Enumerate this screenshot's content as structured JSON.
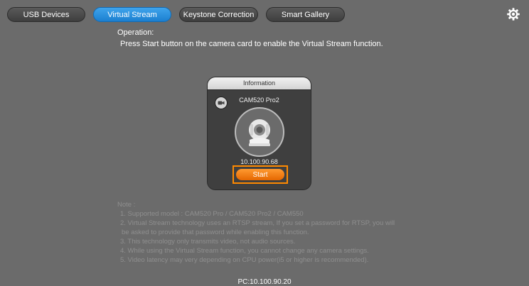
{
  "tabs": [
    {
      "label": "USB Devices",
      "active": false
    },
    {
      "label": "Virtual Stream",
      "active": true
    },
    {
      "label": "Keystone Correction",
      "active": false
    },
    {
      "label": "Smart Gallery",
      "active": false
    }
  ],
  "settings_icon": "gear-icon",
  "operation": {
    "title": "Operation:",
    "text": "Press Start button on the camera card to enable the Virtual Stream function."
  },
  "card": {
    "header": "Information",
    "model": "CAM520 Pro2",
    "ip": "10.100.90.68",
    "start_label": "Start",
    "camera_badge_icon": "video-camera-icon",
    "camera_image_icon": "ptz-camera-icon"
  },
  "notes": {
    "title": "Note :",
    "lines": [
      "1. Supported model : CAM520 Pro / CAM520 Pro2 / CAM550",
      "2. Virtual Stream technology uses an RTSP stream, If you set a password for RTSP, you will",
      "be asked to provide that password while enabling this function.",
      "3. This technology only transmits video, not audio sources.",
      "4. While using the Virtual Stream function, you cannot change any camera settings.",
      "5. Video latency may very depending on CPU power(i5 or higher is recommended)."
    ]
  },
  "footer": {
    "pc_ip": "PC:10.100.90.20"
  },
  "colors": {
    "background": "#6b6b6b",
    "active_tab": "#1b7fd0",
    "start_button": "#f07a10",
    "highlight_border": "#ff8a00"
  }
}
